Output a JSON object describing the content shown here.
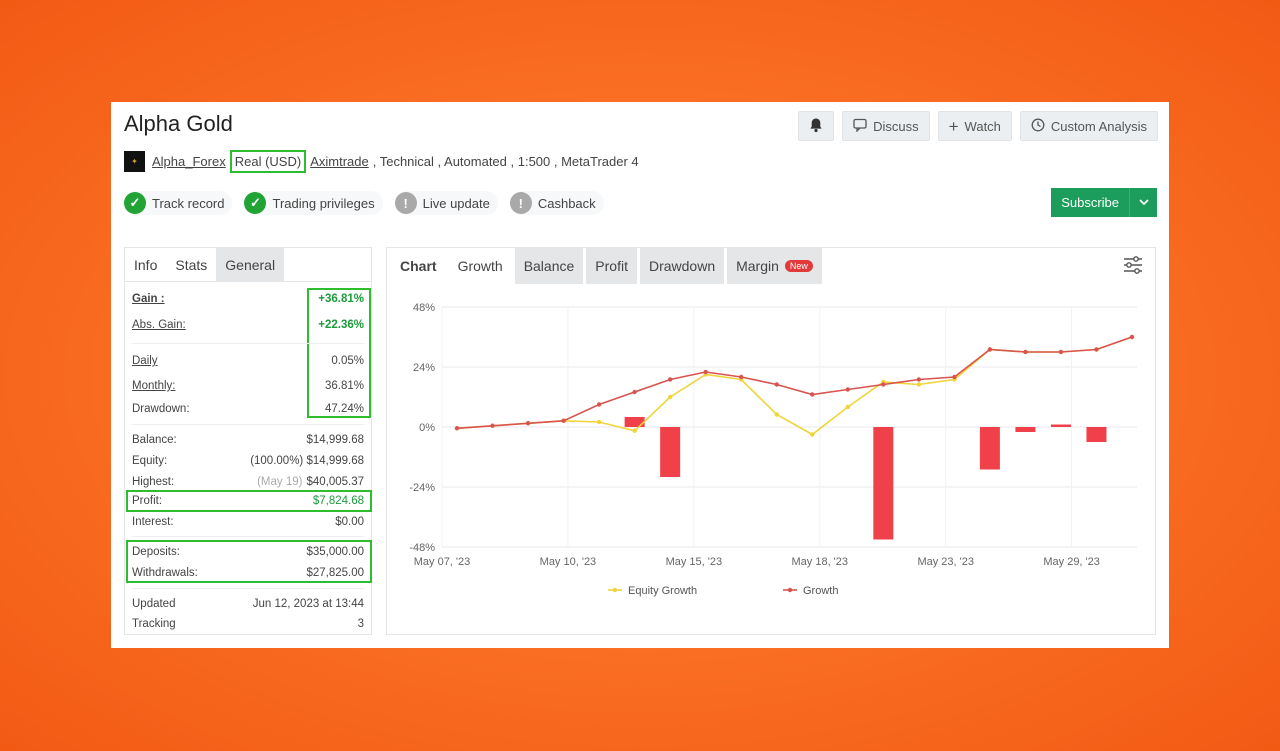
{
  "title": "Alpha Gold",
  "actions": {
    "discuss": "Discuss",
    "watch": "Watch",
    "custom": "Custom Analysis"
  },
  "meta": {
    "owner": "Alpha_Forex",
    "account_type": "Real (USD)",
    "broker": "Aximtrade",
    "rest": ", Technical , Automated , 1:500 , MetaTrader 4"
  },
  "badges": [
    {
      "label": "Track record",
      "state": "ok"
    },
    {
      "label": "Trading privileges",
      "state": "ok"
    },
    {
      "label": "Live update",
      "state": "warn"
    },
    {
      "label": "Cashback",
      "state": "warn"
    }
  ],
  "subscribe": "Subscribe",
  "stats_tabs": [
    "Info",
    "Stats",
    "General"
  ],
  "stats": {
    "gain": {
      "k": "Gain :",
      "v": "+36.81%"
    },
    "abs_gain": {
      "k": "Abs. Gain:",
      "v": "+22.36%"
    },
    "daily": {
      "k": "Daily",
      "v": "0.05%"
    },
    "monthly": {
      "k": "Monthly:",
      "v": "36.81%"
    },
    "drawdown": {
      "k": "Drawdown:",
      "v": "47.24%"
    },
    "balance": {
      "k": "Balance:",
      "v": "$14,999.68"
    },
    "equity": {
      "k": "Equity:",
      "v": "(100.00%) $14,999.68"
    },
    "highest": {
      "k": "Highest:",
      "note": "(May 19)",
      "v": "$40,005.37"
    },
    "profit": {
      "k": "Profit:",
      "v": "$7,824.68"
    },
    "interest": {
      "k": "Interest:",
      "v": "$0.00"
    },
    "deposits": {
      "k": "Deposits:",
      "v": "$35,000.00"
    },
    "withdrawals": {
      "k": "Withdrawals:",
      "v": "$27,825.00"
    },
    "updated": {
      "k": "Updated",
      "v": "Jun 12, 2023 at 13:44"
    },
    "tracking": {
      "k": "Tracking",
      "v": "3"
    }
  },
  "chart_tabs": [
    "Chart",
    "Growth",
    "Balance",
    "Profit",
    "Drawdown",
    "Margin"
  ],
  "new_badge": "New",
  "chart_data": {
    "type": "line",
    "yticks": [
      "48%",
      "24%",
      "0%",
      "-24%",
      "-48%"
    ],
    "ylim": [
      -48,
      48
    ],
    "xticks": [
      "May 07, '23",
      "May 10, '23",
      "May 15, '23",
      "May 18, '23",
      "May 23, '23",
      "May 29, '23"
    ],
    "series": [
      {
        "name": "Growth",
        "color": "#d9534f",
        "values": [
          -0.5,
          0.5,
          1.5,
          2.5,
          9,
          14,
          19,
          22,
          20,
          17,
          13,
          15,
          17,
          19,
          20,
          31,
          30,
          30,
          31,
          36
        ]
      },
      {
        "name": "Equity Growth",
        "color": "#f0d43a",
        "values": [
          -0.5,
          0.5,
          1.5,
          2.5,
          2,
          -1.5,
          12,
          21,
          19,
          5,
          -3,
          8,
          18,
          17,
          19,
          31,
          30,
          30,
          31,
          36
        ]
      }
    ],
    "bars": [
      0,
      0,
      0,
      0,
      0,
      4,
      -20,
      0,
      0,
      0,
      0,
      0,
      -45,
      0,
      0,
      -17,
      -2,
      1,
      -6,
      0
    ],
    "bar_color": "#f0404a",
    "legend": [
      "Equity Growth",
      "Growth"
    ]
  }
}
